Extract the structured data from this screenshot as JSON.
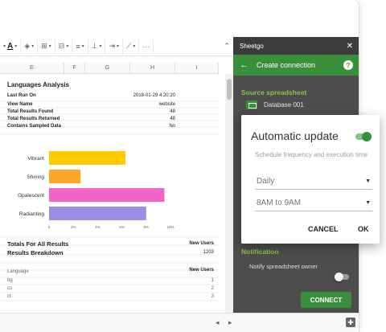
{
  "toolbar": {
    "text_color_label": "A",
    "menu_label": "···",
    "collapse_icon": "chevron-up-icon"
  },
  "columns": [
    "E",
    "F",
    "G",
    "H",
    "I"
  ],
  "report": {
    "title": "Languages Analysis",
    "info": [
      {
        "label": "Last Run On",
        "value": "2018-01-29 4:20:20"
      },
      {
        "label": "View Name",
        "value": "website"
      },
      {
        "label": "Total Results Found",
        "value": "48"
      },
      {
        "label": "Total Results Returned",
        "value": "48"
      },
      {
        "label": "Contains Sampled Data",
        "value": "No"
      }
    ],
    "totals_label": "Totals For All Results",
    "totals_col": "New Users",
    "breakdown_label": "Results Breakdown",
    "breakdown_total": "1203",
    "table_headers": [
      "Language",
      "New Users"
    ],
    "rows": [
      {
        "language": "bg",
        "value": "1"
      },
      {
        "language": "cs",
        "value": "2"
      },
      {
        "language": "ct",
        "value": "3"
      }
    ]
  },
  "chart_data": {
    "type": "bar",
    "orientation": "horizontal",
    "categories": [
      "Vibrant",
      "Shining",
      "Opalescent",
      "Radianting"
    ],
    "values": [
      6.3,
      2.6,
      9.5,
      8.0
    ],
    "colors": [
      "#ffcc00",
      "#ffa726",
      "#f463c5",
      "#9c8ee6"
    ],
    "xticks": [
      "0",
      "2%",
      "4%",
      "6%",
      "8%",
      "10%"
    ],
    "xlim": [
      0,
      10
    ]
  },
  "panel": {
    "app_name": "Sheetgo",
    "close_icon": "close-icon",
    "header_title": "Create connection",
    "source_label": "Source spreadsheet",
    "source_name": "Database 001",
    "notification_label": "Notification",
    "notification_text": "Notify spreadsheet owner",
    "connect_label": "CONNECT",
    "accent": "#3a8f3a"
  },
  "dialog": {
    "title": "Automatic update",
    "toggle_on": true,
    "subtitle": "Schedule frequency and execution time",
    "frequency": "Daily",
    "time": "8AM to 9AM",
    "cancel_label": "CANCEL",
    "ok_label": "OK"
  }
}
